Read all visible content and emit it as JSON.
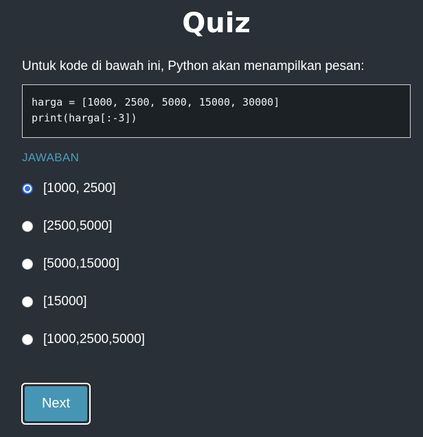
{
  "header": {
    "title": "Quiz"
  },
  "question": {
    "text": "Untuk kode di bawah ini, Python akan menampilkan pesan:",
    "code": [
      "harga = [1000, 2500, 5000, 15000, 30000]",
      "print(harga[:-3])"
    ]
  },
  "answers": {
    "label": "JAWABAN",
    "selected_index": 0,
    "options": [
      "[1000, 2500]",
      "[2500,5000]",
      "[5000,15000]",
      "[15000]",
      "[1000,2500,5000]"
    ]
  },
  "actions": {
    "next_label": "Next"
  },
  "colors": {
    "background": "#2a3037",
    "accent": "#4795b5",
    "answer_label": "#4a9ec2",
    "radio_selected": "#2f6fe0",
    "code_background": "#1c2126"
  }
}
